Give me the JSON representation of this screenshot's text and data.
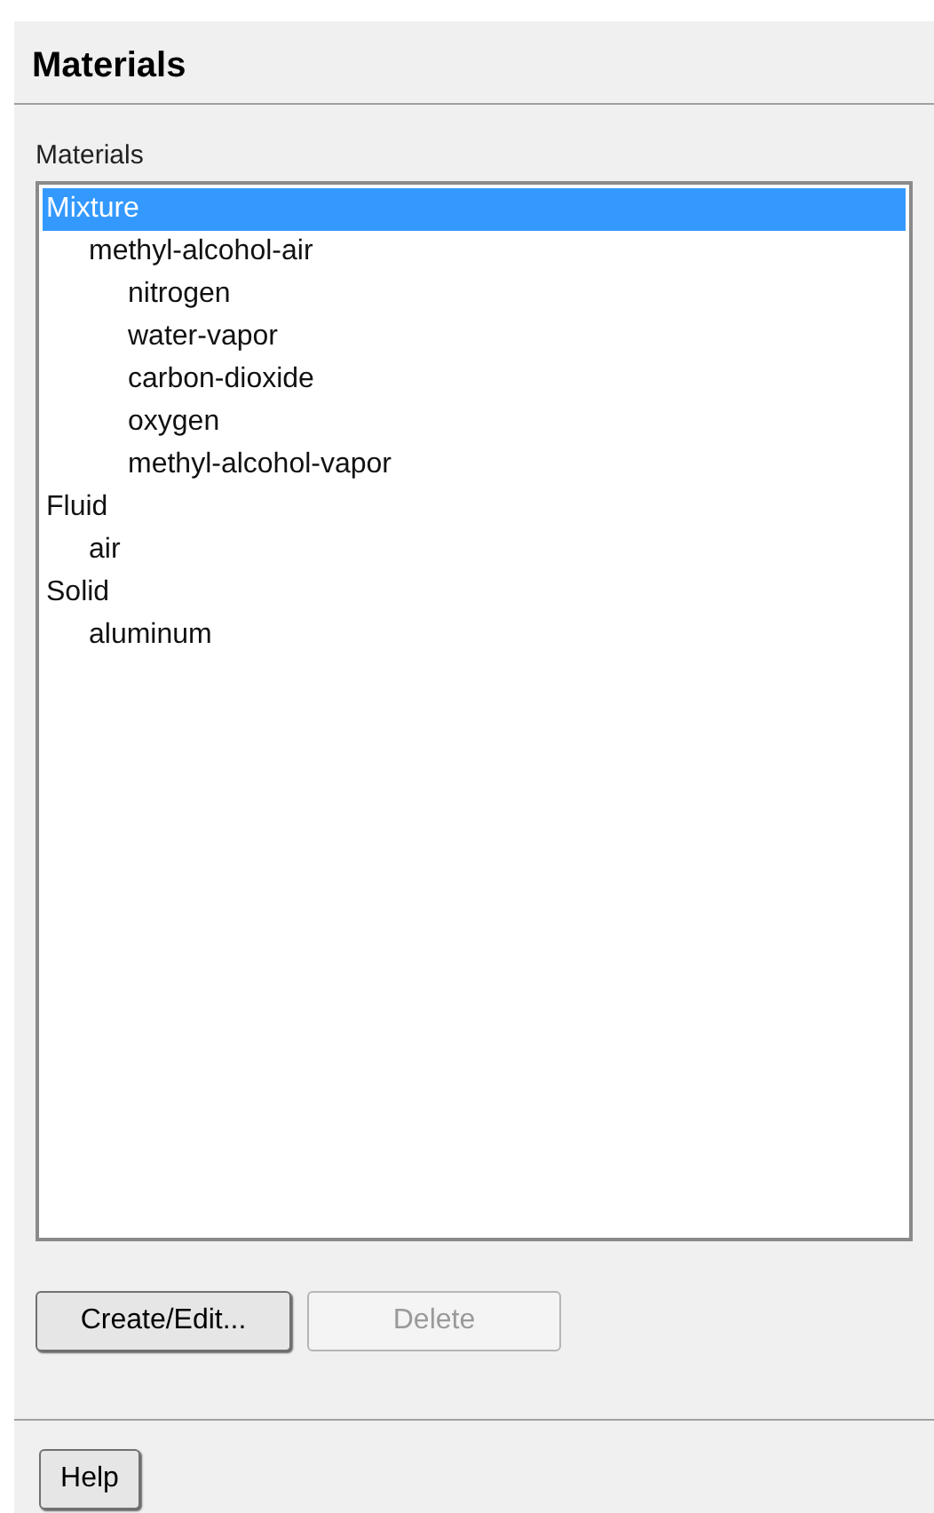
{
  "panel": {
    "title": "Materials"
  },
  "materials_list": {
    "label": "Materials",
    "items": [
      {
        "label": "Mixture",
        "selected": true,
        "children": [
          {
            "label": "methyl-alcohol-air",
            "selected": false,
            "children": [
              {
                "label": "nitrogen",
                "selected": false
              },
              {
                "label": "water-vapor",
                "selected": false
              },
              {
                "label": "carbon-dioxide",
                "selected": false
              },
              {
                "label": "oxygen",
                "selected": false
              },
              {
                "label": "methyl-alcohol-vapor",
                "selected": false
              }
            ]
          }
        ]
      },
      {
        "label": "Fluid",
        "selected": false,
        "children": [
          {
            "label": "air",
            "selected": false
          }
        ]
      },
      {
        "label": "Solid",
        "selected": false,
        "children": [
          {
            "label": "aluminum",
            "selected": false
          }
        ]
      }
    ]
  },
  "buttons": [
    {
      "label": "Create/Edit...",
      "disabled": false
    },
    {
      "label": "Delete",
      "disabled": true
    }
  ],
  "footer_buttons": [
    {
      "label": "Help",
      "disabled": false
    }
  ]
}
